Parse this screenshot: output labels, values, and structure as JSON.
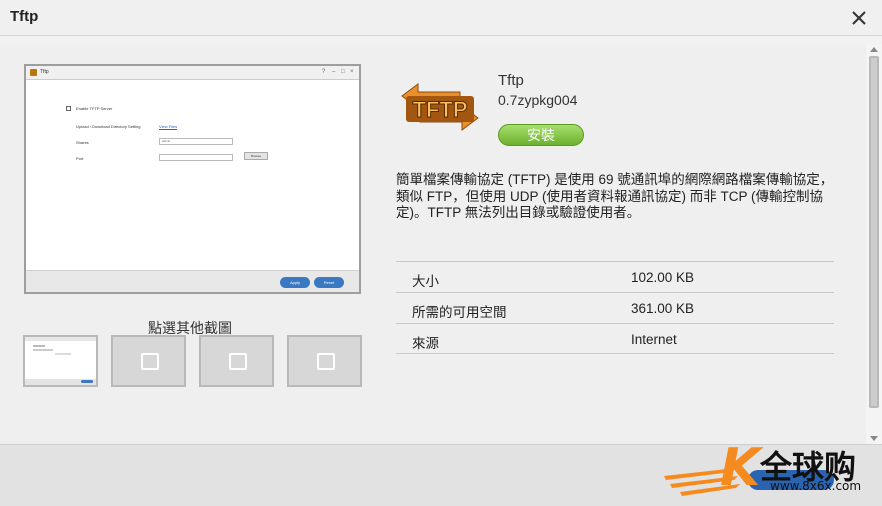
{
  "window": {
    "title": "Tftp"
  },
  "screenshot": {
    "title": "Tftp",
    "enable_label": "Enable TFTP Server",
    "upload_label": "Upload / Download Directory Setting",
    "upload_link": "View Files",
    "share_label": "Shares",
    "share_value": "admin",
    "port_label": "Port",
    "port_value": "",
    "browse_label": "Browse",
    "apply_label": "Apply",
    "reset_label": "Reset"
  },
  "thumbnails": {
    "label": "點選其他截圖",
    "count": 4
  },
  "app": {
    "name": "Tftp",
    "version": "0.7zypkg004",
    "logo_text": "TFTP",
    "install_label": "安裝",
    "description": "簡單檔案傳輸協定 (TFTP) 是使用 69 號通訊埠的網際網路檔案傳輸協定，類似 FTP，但使用 UDP (使用者資料報通訊協定) 而非 TCP (傳輸控制協定)。TFTP 無法列出目錄或驗證使用者。"
  },
  "info": [
    {
      "label": "大小",
      "value": "102.00 KB"
    },
    {
      "label": "所需的可用空間",
      "value": "361.00 KB"
    },
    {
      "label": "來源",
      "value": "Internet"
    }
  ],
  "watermark": {
    "text": "全球购",
    "url": "www.8x6x.com",
    "letter": "K"
  },
  "colors": {
    "install": "#7cbd3a",
    "accent": "#3a78c2",
    "logo": "#e8902a"
  },
  "icons": {
    "close": "close-icon",
    "image": "image-icon"
  }
}
